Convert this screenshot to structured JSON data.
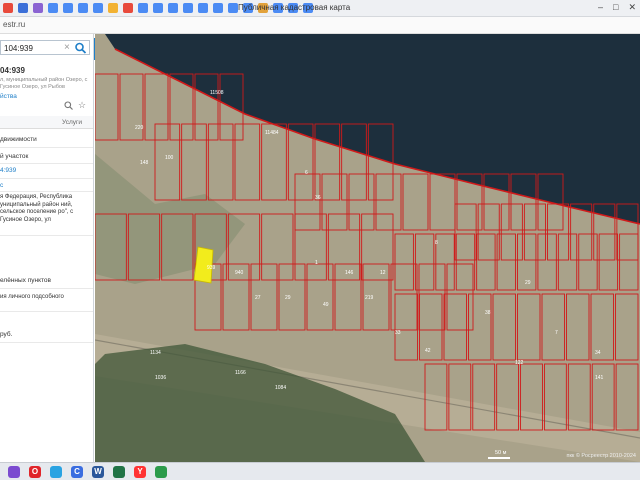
{
  "browser": {
    "page_title": "Публичная кадастровая карта",
    "url_fragment": "estr.ru",
    "window_controls": [
      "–",
      "□",
      "✕"
    ],
    "tab_icon_colors": [
      "#e84a3c",
      "#3b6fd8",
      "#8a63d2",
      "#4b8bf4",
      "#4b8bf4",
      "#4b8bf4",
      "#4b8bf4",
      "#f2b233",
      "#e84a3c",
      "#4b8bf4",
      "#4b8bf4",
      "#4b8bf4",
      "#4b8bf4",
      "#4b8bf4",
      "#4b8bf4",
      "#4b8bf4",
      "#4b8bf4",
      "#e2a23b",
      "#4b8bf4",
      "#4b8bf4",
      "#4b8bf4"
    ]
  },
  "sidebar": {
    "search_value": "104:939",
    "search_clear": "×",
    "object_number": "04:939",
    "object_address": "л, муниципальный район Озеро, с Гусиное Озеро, ул Рыбов",
    "object_link": "йства",
    "tab_label": "Услуги",
    "rows": [
      {
        "text": "движимости",
        "style": ""
      },
      {
        "text": "й участок",
        "style": ""
      },
      {
        "text": "4:939",
        "style": "blue"
      },
      {
        "text": "с",
        "style": "blue"
      },
      {
        "text": "я Федерация, Республика униципальный район ний, сельское поселение ро\", с Гусиное Озеро, ул",
        "style": "small"
      },
      {
        "text": "елённых пунктов",
        "style": ""
      },
      {
        "text": "ия личного подсобного",
        "style": "small"
      },
      {
        "text": "руб.",
        "style": ""
      }
    ]
  },
  "map": {
    "copyright": "пкк © Росреестр 2010-2024",
    "scale": "50 м",
    "water_color": "#1d2f3d",
    "land_color": "#a9a28a",
    "parcel_line_color": "#d01a1a",
    "selected_parcel_color": "#f2ec1c",
    "parcel_labels": [
      "11484",
      "11508",
      "1166",
      "6",
      "220",
      "100",
      "148",
      "36",
      "939",
      "940",
      "27",
      "29",
      "49",
      "146",
      "219",
      "12",
      "1",
      "8",
      "33",
      "42",
      "1134",
      "1036",
      "1084",
      "29",
      "7",
      "122",
      "141",
      "34",
      "38"
    ]
  },
  "taskbar": {
    "icons": [
      {
        "name": "start-icon",
        "color": "#7b4bd0",
        "glyph": ""
      },
      {
        "name": "opera-icon",
        "color": "#e0252a",
        "glyph": "O"
      },
      {
        "name": "telegram-icon",
        "color": "#2aa3e2",
        "glyph": ""
      },
      {
        "name": "browser-icon",
        "color": "#3a6de0",
        "glyph": "C"
      },
      {
        "name": "word-icon",
        "color": "#2b579a",
        "glyph": "W"
      },
      {
        "name": "excel-icon",
        "color": "#217346",
        "glyph": ""
      },
      {
        "name": "yandex-icon",
        "color": "#ff3333",
        "glyph": "Y"
      },
      {
        "name": "chrome-icon",
        "color": "#2c9b4b",
        "glyph": ""
      }
    ]
  }
}
